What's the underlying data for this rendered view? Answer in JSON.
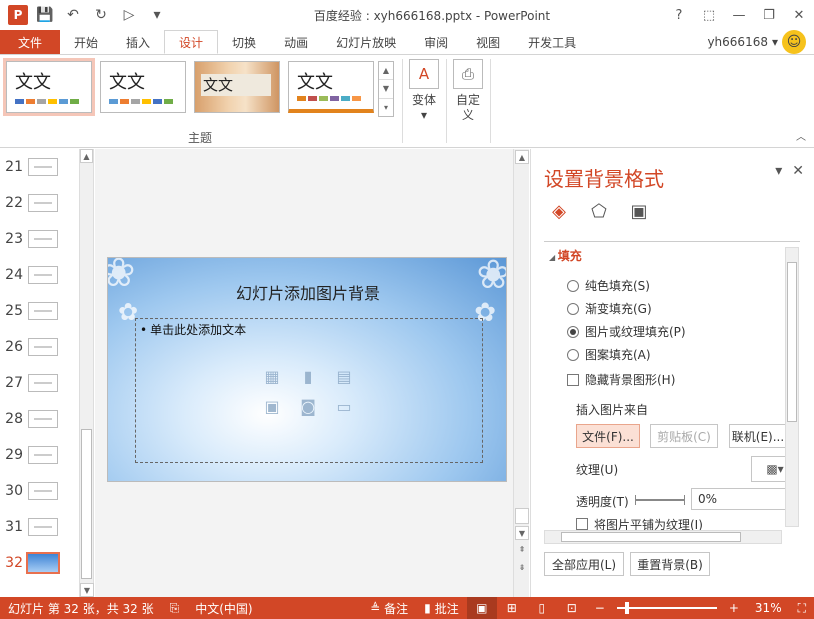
{
  "window": {
    "title": "百度经验 : xyh666168.pptx - PowerPoint",
    "app_logo": "P",
    "controls": [
      "?",
      "⬚",
      "—",
      "❐",
      "✕"
    ]
  },
  "qat": {
    "save_icon": "save-icon",
    "undo_icon": "undo-icon",
    "redo_icon": "redo-icon",
    "present_icon": "present-icon",
    "customize_icon": "customize-icon"
  },
  "tabs": {
    "file": "文件",
    "items": [
      "开始",
      "插入",
      "设计",
      "切换",
      "动画",
      "幻灯片放映",
      "审阅",
      "视图",
      "开发工具"
    ],
    "active": "设计",
    "user": "yh666168",
    "user_caret": "▾"
  },
  "ribbon": {
    "theme_sample": "文文",
    "theme_group_label": "主题",
    "variants_label": "变体",
    "customize_label_1": "自定",
    "customize_label_2": "义"
  },
  "thumbnails": {
    "numbers": [
      "21",
      "22",
      "23",
      "24",
      "25",
      "26",
      "27",
      "28",
      "29",
      "30",
      "31",
      "32"
    ],
    "selected": "32"
  },
  "slide": {
    "title": "幻灯片添加图片背景",
    "placeholder_text": "单击此处添加文本"
  },
  "format_pane": {
    "title": "设置背景格式",
    "section_fill": "填充",
    "options": [
      "纯色填充(S)",
      "渐变填充(G)",
      "图片或纹理填充(P)",
      "图案填充(A)"
    ],
    "selected_option": "图片或纹理填充(P)",
    "hide_bg_graphics": "隐藏背景图形(H)",
    "insert_from": "插入图片来自",
    "btn_file": "文件(F)...",
    "btn_clipboard": "剪贴板(C)",
    "btn_online": "联机(E)...",
    "texture_label": "纹理(U)",
    "transparency_label": "透明度(T)",
    "transparency_value": "0%",
    "tile_label": "将图片平铺为纹理(I)",
    "apply_all": "全部应用(L)",
    "reset_bg": "重置背景(B)"
  },
  "status": {
    "slide_info": "幻灯片 第 32 张，共 32 张",
    "language": "中文(中国)",
    "notes": "备注",
    "comments": "批注",
    "zoom": "31%"
  },
  "colors": {
    "accent": "#d24726",
    "status_bar": "#d24726"
  }
}
